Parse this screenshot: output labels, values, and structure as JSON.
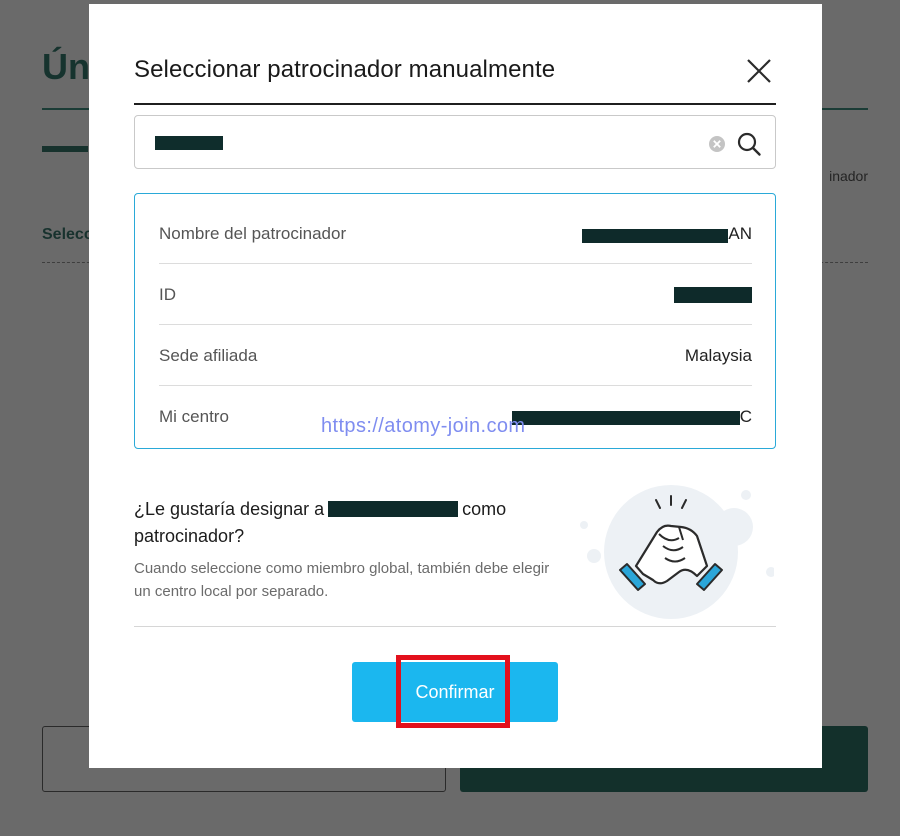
{
  "background": {
    "title": "Ún",
    "right_text": "inador",
    "label": "Selecc"
  },
  "modal": {
    "title": "Seleccionar patrocinador manualmente",
    "close_icon": "close-icon"
  },
  "search": {
    "value": "",
    "icons": [
      "clear-icon",
      "search-icon"
    ]
  },
  "info": {
    "rows": [
      {
        "label": "Nombre del patrocinador",
        "value": "AN"
      },
      {
        "label": "ID",
        "value": ""
      },
      {
        "label": "Sede afiliada",
        "value": "Malaysia"
      },
      {
        "label": "Mi centro",
        "value": "C"
      }
    ]
  },
  "watermark": "https://atomy-join.com",
  "question": {
    "prefix": "¿Le gustaría designar a",
    "suffix": "como patrocinador?",
    "note": "Cuando seleccione como miembro global, también debe elegir un centro local por separado."
  },
  "illustration": "handshake-icon",
  "confirm": {
    "label": "Confirmar"
  },
  "colors": {
    "accent": "#1bb7ef",
    "card_border": "#2aa9d8",
    "highlight": "#e3101c",
    "dark_green": "#13302b"
  }
}
